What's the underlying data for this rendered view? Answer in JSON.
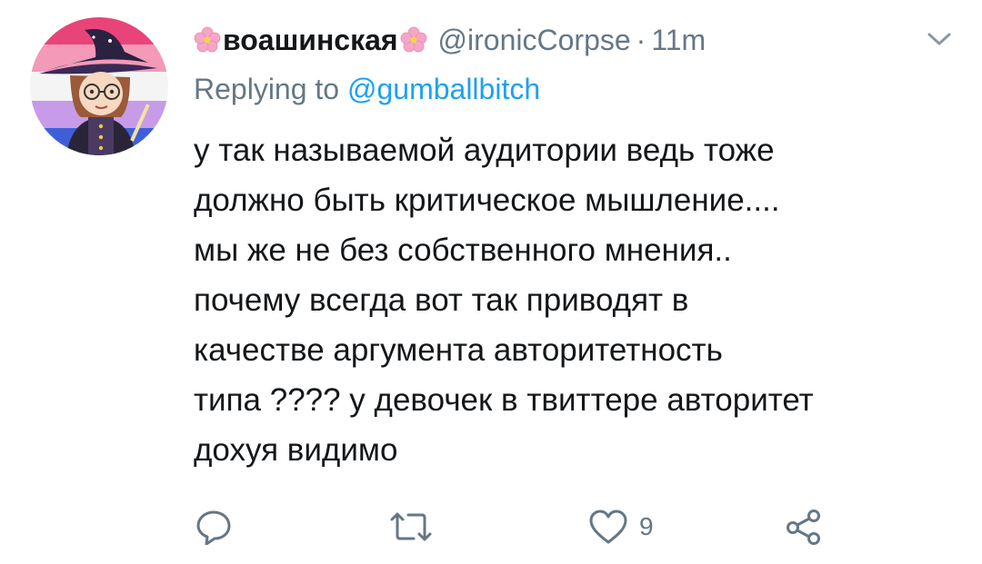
{
  "tweet": {
    "display_name": "воашинская",
    "handle": "@ironicCorpse",
    "separator": "·",
    "time": "11m",
    "reply_prefix": "Replying to",
    "reply_to": "@gumballbitch",
    "text_lines": [
      "у так называемой аудитории ведь тоже",
      "должно быть критическое мышление....",
      "мы же не без собственного мнения..",
      "почему всегда вот так приводят в",
      "качестве аргумента авторитетность",
      "типа ???? у девочек в твиттере авторитет",
      "дохуя видимо"
    ]
  },
  "actions": {
    "like_count": "9"
  },
  "icons": {
    "avatar": "user-avatar",
    "name_decoration": "cherry-blossom-icon",
    "menu": "chevron-down-icon",
    "reply": "reply-icon",
    "retweet": "retweet-icon",
    "like": "heart-icon",
    "share": "share-icon"
  },
  "colors": {
    "text": "#14171a",
    "secondary": "#657786",
    "link": "#1da1f2",
    "flower": "#f4a6c8"
  }
}
